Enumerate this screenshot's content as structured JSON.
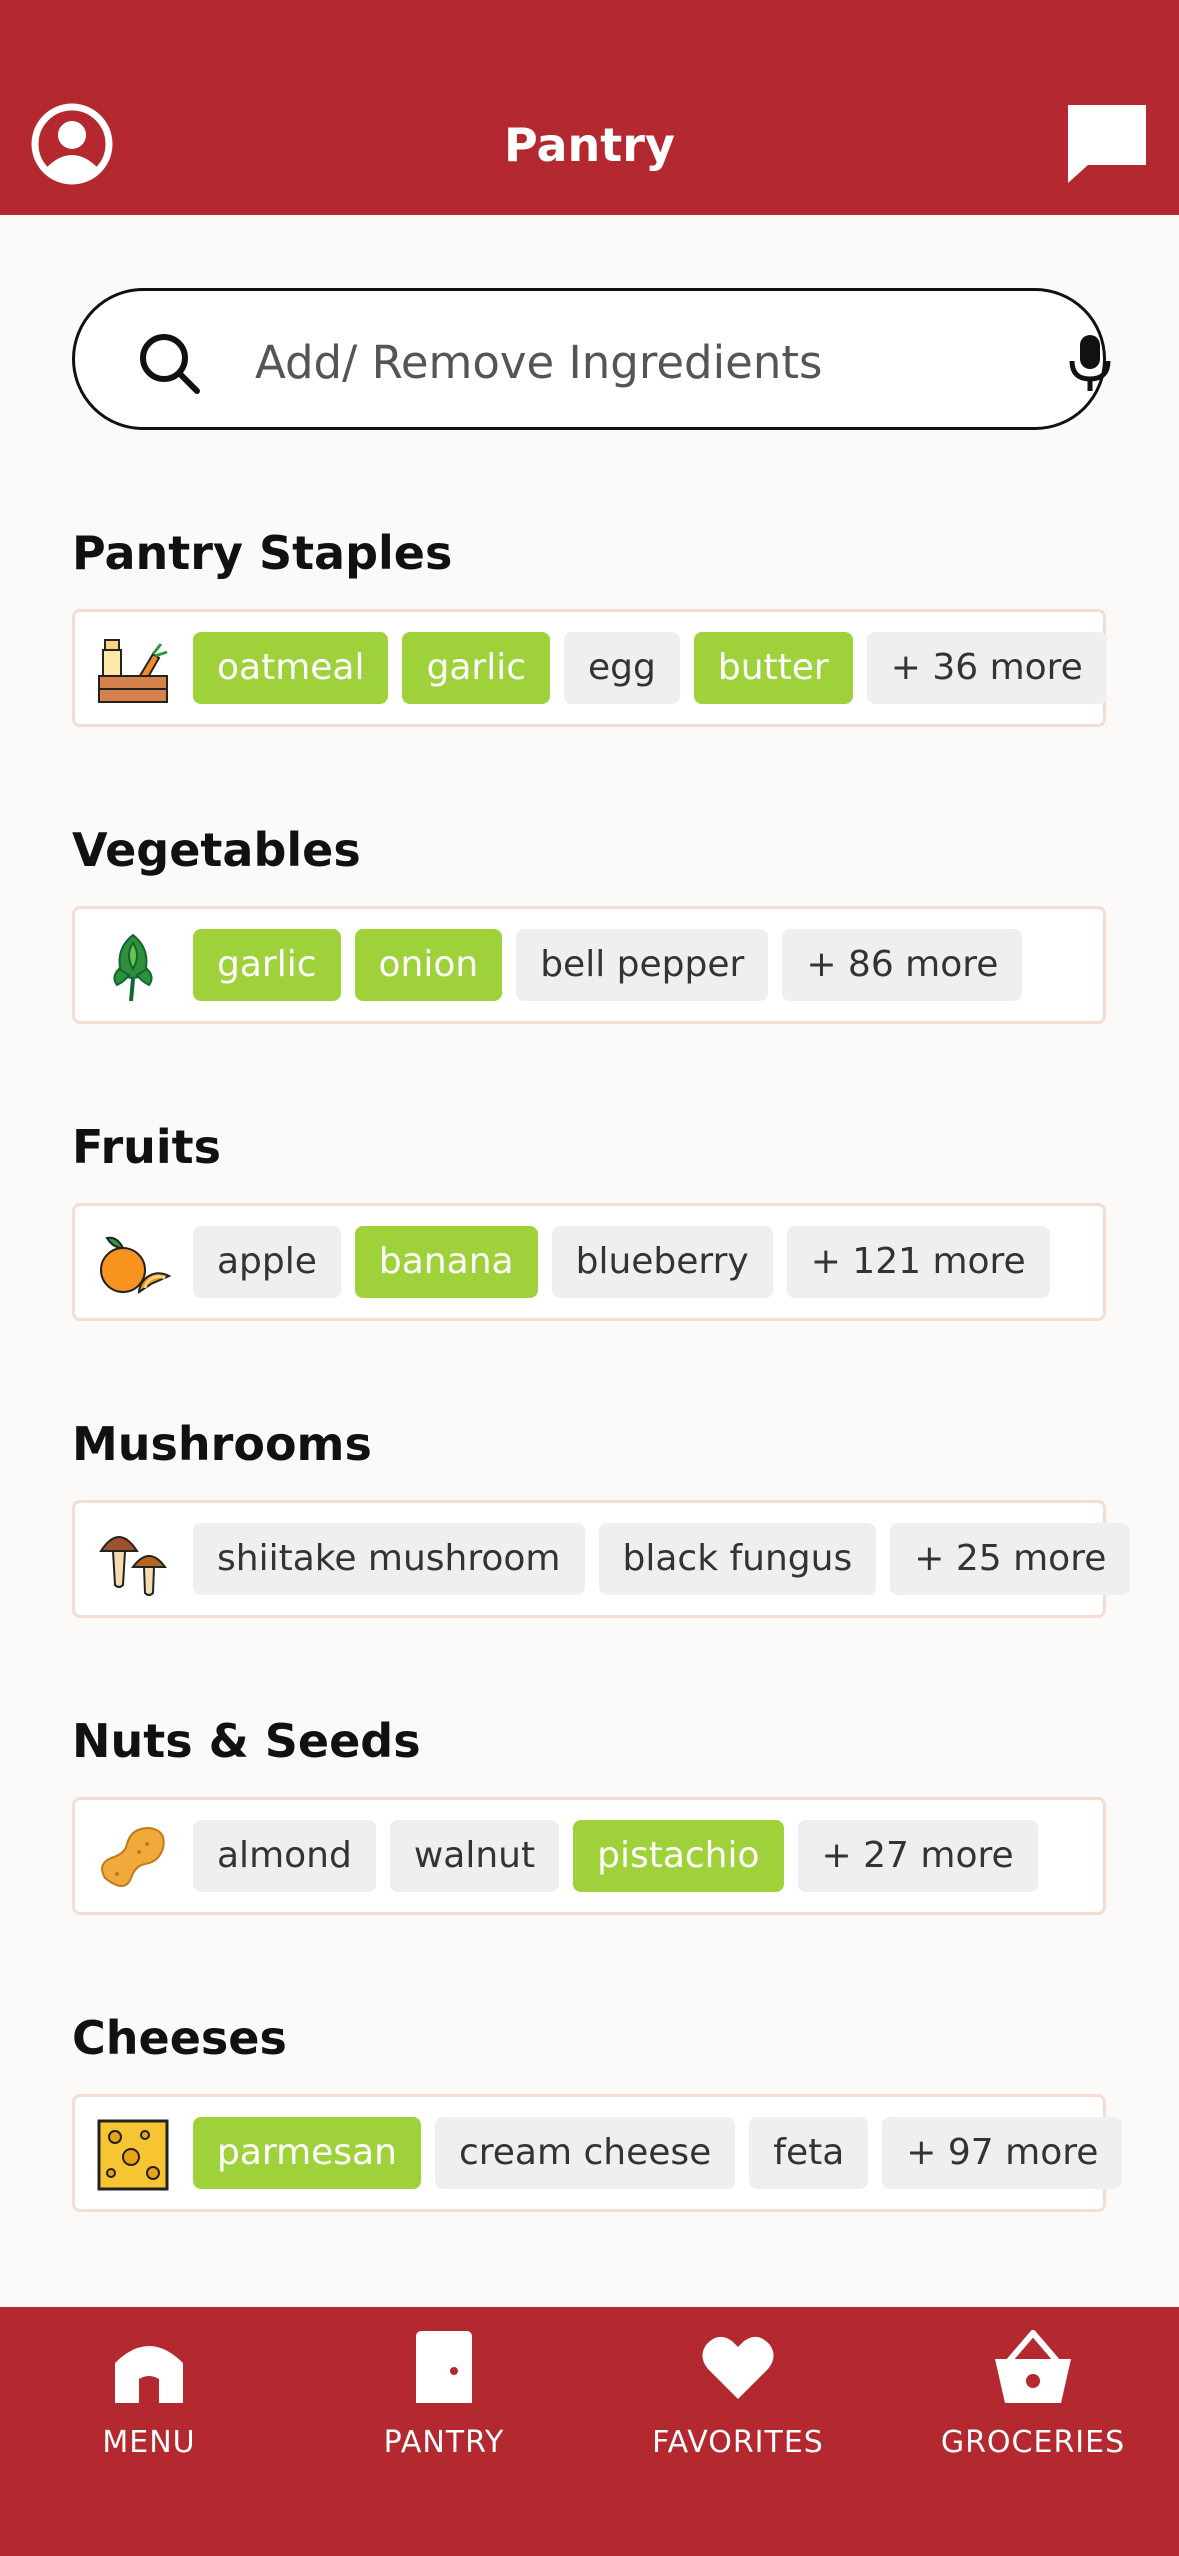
{
  "header": {
    "title": "Pantry"
  },
  "search": {
    "placeholder": "Add/ Remove Ingredients"
  },
  "sections": [
    {
      "title": "Pantry Staples",
      "icon": "pantry-crate-icon",
      "chips": [
        {
          "label": "oatmeal",
          "selected": true
        },
        {
          "label": "garlic",
          "selected": true
        },
        {
          "label": "egg",
          "selected": false
        },
        {
          "label": "butter",
          "selected": true
        },
        {
          "label": "+ 36 more",
          "selected": false
        }
      ]
    },
    {
      "title": "Vegetables",
      "icon": "artichoke-icon",
      "chips": [
        {
          "label": "garlic",
          "selected": true
        },
        {
          "label": "onion",
          "selected": true
        },
        {
          "label": "bell pepper",
          "selected": false
        },
        {
          "label": "+ 86 more",
          "selected": false
        }
      ]
    },
    {
      "title": "Fruits",
      "icon": "orange-icon",
      "chips": [
        {
          "label": "apple",
          "selected": false
        },
        {
          "label": "banana",
          "selected": true
        },
        {
          "label": "blueberry",
          "selected": false
        },
        {
          "label": "+ 121 more",
          "selected": false
        }
      ]
    },
    {
      "title": "Mushrooms",
      "icon": "mushroom-icon",
      "chips": [
        {
          "label": "shiitake mushroom",
          "selected": false
        },
        {
          "label": "black fungus",
          "selected": false
        },
        {
          "label": "+ 25 more",
          "selected": false
        }
      ]
    },
    {
      "title": "Nuts & Seeds",
      "icon": "peanut-icon",
      "chips": [
        {
          "label": "almond",
          "selected": false
        },
        {
          "label": "walnut",
          "selected": false
        },
        {
          "label": "pistachio",
          "selected": true
        },
        {
          "label": "+ 27 more",
          "selected": false
        }
      ]
    },
    {
      "title": "Cheeses",
      "icon": "cheese-icon",
      "chips": [
        {
          "label": "parmesan",
          "selected": true
        },
        {
          "label": "cream cheese",
          "selected": false
        },
        {
          "label": "feta",
          "selected": false
        },
        {
          "label": "+ 97 more",
          "selected": false
        }
      ]
    }
  ],
  "tabbar": [
    {
      "label": "MENU",
      "icon": "home-icon"
    },
    {
      "label": "PANTRY",
      "icon": "door-icon"
    },
    {
      "label": "FAVORITES",
      "icon": "heart-icon"
    },
    {
      "label": "GROCERIES",
      "icon": "basket-icon"
    }
  ],
  "colors": {
    "brand": "#b3292f",
    "selected_chip": "#9fd23a",
    "chip": "#efefef",
    "background": "#fcfaf9"
  }
}
